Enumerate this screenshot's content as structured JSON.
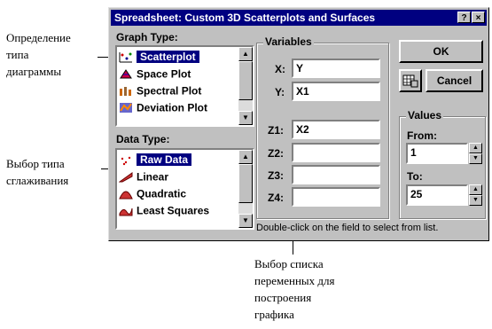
{
  "annotations": {
    "graph_type": [
      "Определение",
      "типа",
      "диаграммы"
    ],
    "smoothing": [
      "Выбор типа",
      "сглаживания"
    ],
    "variables": [
      "Выбор списка",
      "переменных для",
      "построения",
      "графика"
    ]
  },
  "dialog": {
    "title": "Spreadsheet: Custom 3D Scatterplots and Surfaces",
    "help_button": "?",
    "close_button": "×",
    "graph_type": {
      "label": "Graph Type:",
      "items": [
        {
          "label": "Scatterplot",
          "icon": "scatterplot-icon",
          "selected": true
        },
        {
          "label": "Space Plot",
          "icon": "space-plot-icon"
        },
        {
          "label": "Spectral Plot",
          "icon": "spectral-plot-icon"
        },
        {
          "label": "Deviation Plot",
          "icon": "deviation-plot-icon"
        }
      ]
    },
    "data_type": {
      "label": "Data Type:",
      "items": [
        {
          "label": "Raw Data",
          "icon": "raw-data-icon",
          "selected": true
        },
        {
          "label": "Linear",
          "icon": "linear-icon"
        },
        {
          "label": "Quadratic",
          "icon": "quadratic-icon"
        },
        {
          "label": "Least Squares",
          "icon": "least-squares-icon"
        }
      ]
    },
    "variables": {
      "label": "Variables",
      "x_label": "X:",
      "x_value": "Y",
      "y_label": "Y:",
      "y_value": "X1",
      "z1_label": "Z1:",
      "z1_value": "X2",
      "z2_label": "Z2:",
      "z2_value": "",
      "z3_label": "Z3:",
      "z3_value": "",
      "z4_label": "Z4:",
      "z4_value": ""
    },
    "ok_button": "OK",
    "cancel_button": "Cancel",
    "values": {
      "label": "Values",
      "from_label": "From:",
      "from_value": "1",
      "to_label": "To:",
      "to_value": "25"
    },
    "hint": "Double-click on the field to select from list."
  }
}
